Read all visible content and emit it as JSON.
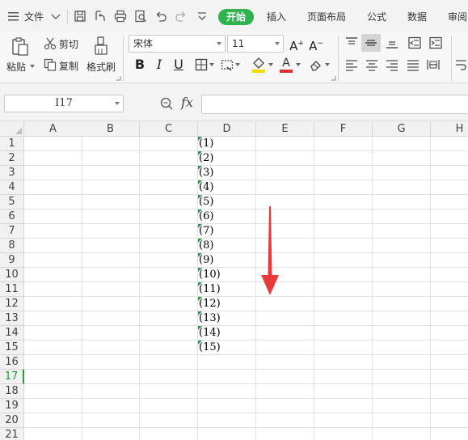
{
  "menubar": {
    "file_label": "文件",
    "tabs": [
      {
        "label": "开始",
        "active": true
      },
      {
        "label": "插入"
      },
      {
        "label": "页面布局"
      },
      {
        "label": "公式"
      },
      {
        "label": "数据"
      },
      {
        "label": "审阅"
      }
    ]
  },
  "ribbon": {
    "paste_label": "粘贴",
    "cut_label": "剪切",
    "copy_label": "复制",
    "format_painter_label": "格式刷",
    "font_name": "宋体",
    "font_size": "11",
    "font_color": "#e03030",
    "fill_color": "#f5d800"
  },
  "formula_bar": {
    "cell_reference": "I17",
    "fx_label": "fx",
    "formula": ""
  },
  "sheet": {
    "columns": [
      "A",
      "B",
      "C",
      "D",
      "E",
      "F",
      "G",
      "H"
    ],
    "rows": [
      "1",
      "2",
      "3",
      "4",
      "5",
      "6",
      "7",
      "8",
      "9",
      "10",
      "11",
      "12",
      "13",
      "14",
      "15",
      "16",
      "17",
      "18",
      "19",
      "20",
      "21"
    ],
    "selected_row": "17",
    "column_d_values": [
      "(1)",
      "(2)",
      "(3)",
      "(4)",
      "(5)",
      "(6)",
      "(7)",
      "(8)",
      "(9)",
      "(10)",
      "(11)",
      "(12)",
      "(13)",
      "(14)",
      "(15)"
    ]
  },
  "annotation": {
    "arrow_color": "#e83a3a",
    "arrow_direction": "down"
  },
  "colors": {
    "accent": "#2eb34f",
    "selected_row_header": "#1e9e3e"
  }
}
